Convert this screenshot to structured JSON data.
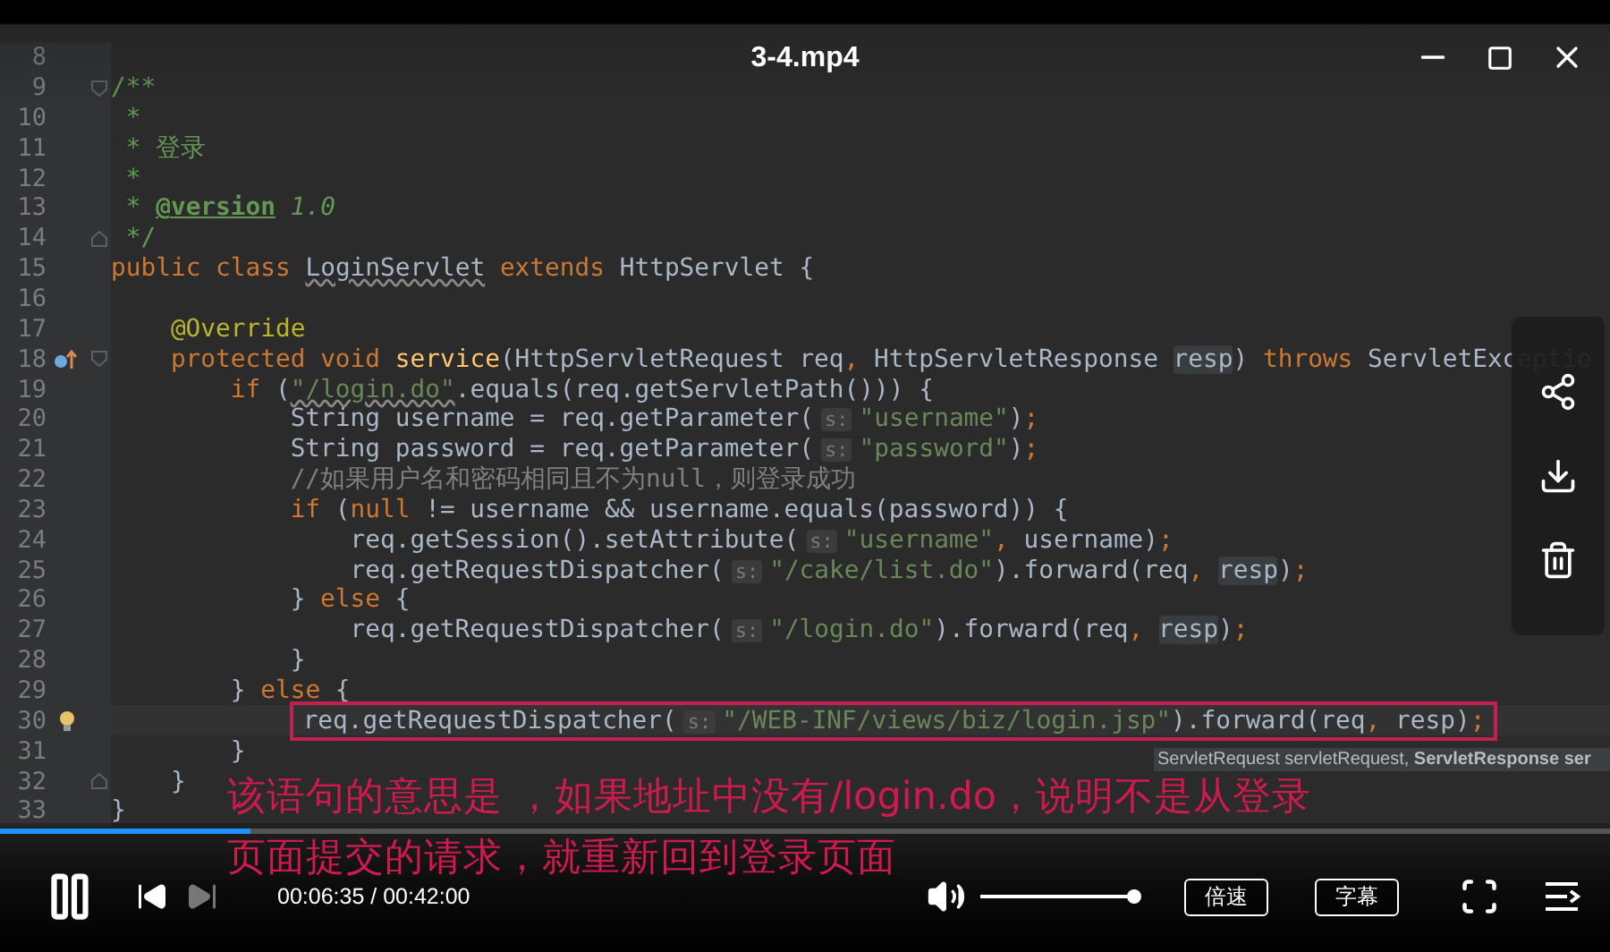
{
  "window": {
    "title": "3-4.mp4"
  },
  "code": {
    "lines": [
      {
        "number": "8"
      },
      {
        "number": "9",
        "fold_start": true,
        "tokens": [
          {
            "kind": "doc",
            "text": "/**"
          }
        ]
      },
      {
        "number": "10",
        "tokens": [
          {
            "kind": "doc",
            "text": " *"
          }
        ]
      },
      {
        "number": "11",
        "tokens": [
          {
            "kind": "doc",
            "text": " * 登录"
          }
        ]
      },
      {
        "number": "12",
        "tokens": [
          {
            "kind": "doc",
            "text": " *"
          }
        ]
      },
      {
        "number": "13",
        "tokens": [
          {
            "kind": "doc",
            "text": " * "
          },
          {
            "kind": "doctag",
            "text": "@version"
          },
          {
            "kind": "docitalic",
            "text": " 1.0"
          }
        ]
      },
      {
        "number": "14",
        "fold_end": true,
        "tokens": [
          {
            "kind": "doc",
            "text": " */"
          }
        ]
      },
      {
        "number": "15",
        "tokens": [
          {
            "kind": "keyword",
            "text": "public class "
          },
          {
            "kind": "warn",
            "text": "LoginServlet"
          },
          {
            "kind": "keyword",
            "text": " extends "
          },
          {
            "kind": "plain",
            "text": "HttpServlet {"
          }
        ]
      },
      {
        "number": "16"
      },
      {
        "number": "17",
        "tokens": [
          {
            "kind": "annotation",
            "text": "    @Override"
          }
        ]
      },
      {
        "number": "18",
        "fold_start": true,
        "override_marker": true,
        "tokens": [
          {
            "kind": "keyword",
            "text": "    protected void "
          },
          {
            "kind": "method",
            "text": "service"
          },
          {
            "kind": "plain",
            "text": "(HttpServletRequest req"
          },
          {
            "kind": "keyword",
            "text": ","
          },
          {
            "kind": "plain",
            "text": " HttpServletResponse "
          },
          {
            "kind": "ref",
            "text": "resp"
          },
          {
            "kind": "plain",
            "text": ") "
          },
          {
            "kind": "keyword",
            "text": "throws"
          },
          {
            "kind": "plain",
            "text": " ServletExceptio"
          }
        ]
      },
      {
        "number": "19",
        "tokens": [
          {
            "kind": "keyword",
            "text": "        if"
          },
          {
            "kind": "plain",
            "text": " ("
          },
          {
            "kind": "stringwarn",
            "text": "\"/login.do\""
          },
          {
            "kind": "plain",
            "text": ".equals(req.getServletPath())) {"
          }
        ]
      },
      {
        "number": "20",
        "tokens": [
          {
            "kind": "plain",
            "text": "            String username = req.getParameter("
          },
          {
            "kind": "hint",
            "text": "s:"
          },
          {
            "kind": "string",
            "text": "\"username\""
          },
          {
            "kind": "plain",
            "text": ")"
          },
          {
            "kind": "keyword",
            "text": ";"
          }
        ]
      },
      {
        "number": "21",
        "tokens": [
          {
            "kind": "plain",
            "text": "            String password = req.getParameter("
          },
          {
            "kind": "hint",
            "text": "s:"
          },
          {
            "kind": "string",
            "text": "\"password\""
          },
          {
            "kind": "plain",
            "text": ")"
          },
          {
            "kind": "keyword",
            "text": ";"
          }
        ]
      },
      {
        "number": "22",
        "tokens": [
          {
            "kind": "comment",
            "text": "            //如果用户名和密码相同且不为null，则登录成功"
          }
        ]
      },
      {
        "number": "23",
        "tokens": [
          {
            "kind": "keyword",
            "text": "            if"
          },
          {
            "kind": "plain",
            "text": " ("
          },
          {
            "kind": "keyword",
            "text": "null"
          },
          {
            "kind": "plain",
            "text": " != username && username.equals(password)) {"
          }
        ]
      },
      {
        "number": "24",
        "tokens": [
          {
            "kind": "plain",
            "text": "                req.getSession().setAttribute("
          },
          {
            "kind": "hint",
            "text": "s:"
          },
          {
            "kind": "string",
            "text": "\"username\""
          },
          {
            "kind": "keyword",
            "text": ","
          },
          {
            "kind": "plain",
            "text": " username)"
          },
          {
            "kind": "keyword",
            "text": ";"
          }
        ]
      },
      {
        "number": "25",
        "tokens": [
          {
            "kind": "plain",
            "text": "                req.getRequestDispatcher("
          },
          {
            "kind": "hint",
            "text": "s:"
          },
          {
            "kind": "string",
            "text": "\"/cake/list.do\""
          },
          {
            "kind": "plain",
            "text": ").forward(req"
          },
          {
            "kind": "keyword",
            "text": ", "
          },
          {
            "kind": "ref",
            "text": "resp"
          },
          {
            "kind": "plain",
            "text": ")"
          },
          {
            "kind": "keyword",
            "text": ";"
          }
        ]
      },
      {
        "number": "26",
        "tokens": [
          {
            "kind": "plain",
            "text": "            } "
          },
          {
            "kind": "keyword",
            "text": "else"
          },
          {
            "kind": "plain",
            "text": " {"
          }
        ]
      },
      {
        "number": "27",
        "tokens": [
          {
            "kind": "plain",
            "text": "                req.getRequestDispatcher("
          },
          {
            "kind": "hint",
            "text": "s:"
          },
          {
            "kind": "string",
            "text": "\"/login.do\""
          },
          {
            "kind": "plain",
            "text": ").forward(req"
          },
          {
            "kind": "keyword",
            "text": ", "
          },
          {
            "kind": "ref",
            "text": "resp"
          },
          {
            "kind": "plain",
            "text": ")"
          },
          {
            "kind": "keyword",
            "text": ";"
          }
        ]
      },
      {
        "number": "28",
        "tokens": [
          {
            "kind": "plain",
            "text": "            }"
          }
        ]
      },
      {
        "number": "29",
        "tokens": [
          {
            "kind": "plain",
            "text": "        } "
          },
          {
            "kind": "keyword",
            "text": "else"
          },
          {
            "kind": "plain",
            "text": " {"
          }
        ]
      },
      {
        "number": "30",
        "boxed": true,
        "bulb": true,
        "tokens": [
          {
            "kind": "plain",
            "text": "            req.getRequestDispatcher("
          },
          {
            "kind": "hint",
            "text": "s:"
          },
          {
            "kind": "string",
            "text": "\"/WEB-INF/views/biz/login.jsp\""
          },
          {
            "kind": "plain",
            "text": ").forward(req"
          },
          {
            "kind": "keyword",
            "text": ","
          },
          {
            "kind": "plain",
            "text": " resp)"
          },
          {
            "kind": "keyword",
            "text": ";"
          }
        ]
      },
      {
        "number": "31",
        "tokens": [
          {
            "kind": "plain",
            "text": "        }"
          }
        ]
      },
      {
        "number": "32",
        "fold_end": true,
        "tokens": [
          {
            "kind": "plain",
            "text": "    }"
          }
        ]
      },
      {
        "number": "33",
        "tokens": [
          {
            "kind": "plain",
            "text": "}"
          }
        ]
      }
    ],
    "tooltip": "ServletRequest servletRequest, **ServletResponse ser**"
  },
  "subtitle": [
    "该语句的意思是 ，如果地址中没有/login.do，说明不是从登录",
    "页面提交的请求，就重新回到登录页面"
  ],
  "player": {
    "progress": {
      "level": 0.155
    },
    "time": "00:06:35 / 00:42:00",
    "next_disabled": true,
    "volume": {
      "level": 1
    },
    "buttons": [
      {
        "label": "倍速"
      },
      {
        "label": "字幕"
      }
    ]
  }
}
